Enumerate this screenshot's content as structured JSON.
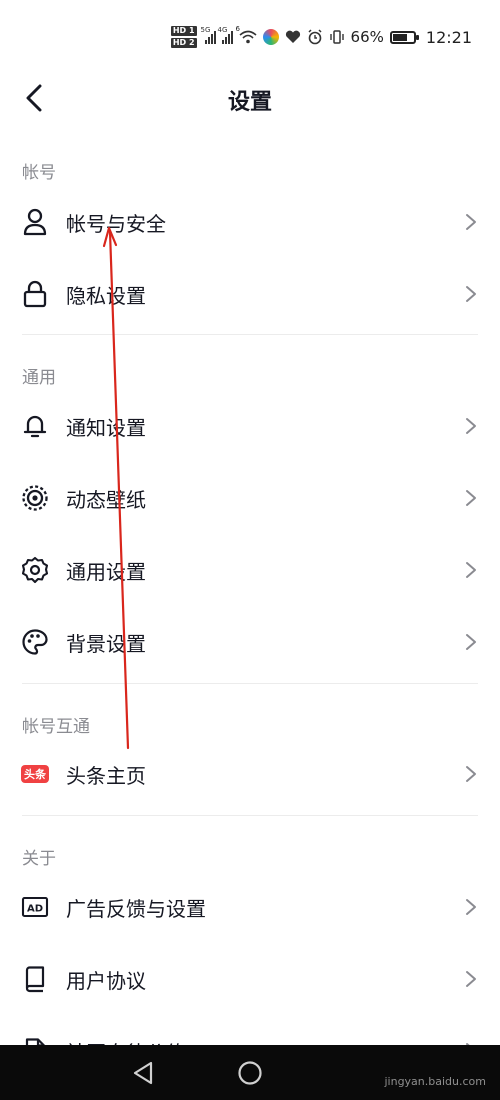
{
  "status_bar": {
    "hd1": "HD 1",
    "hd2": "HD 2",
    "net1": "5G",
    "net2": "4G",
    "wifi_badge": "6",
    "battery_percent": "66%",
    "battery_level": 0.66,
    "time": "12:21"
  },
  "header": {
    "title": "设置"
  },
  "sections": [
    {
      "title": "帐号",
      "items": [
        {
          "label": "帐号与安全",
          "icon": "user-icon"
        },
        {
          "label": "隐私设置",
          "icon": "lock-icon"
        }
      ]
    },
    {
      "title": "通用",
      "items": [
        {
          "label": "通知设置",
          "icon": "bell-icon"
        },
        {
          "label": "动态壁纸",
          "icon": "live-wallpaper-icon"
        },
        {
          "label": "通用设置",
          "icon": "gear-icon"
        },
        {
          "label": "背景设置",
          "icon": "palette-icon"
        }
      ]
    },
    {
      "title": "帐号互通",
      "items": [
        {
          "label": "头条主页",
          "icon": "toutiao-icon",
          "badge": "头条"
        }
      ]
    },
    {
      "title": "关于",
      "items": [
        {
          "label": "广告反馈与设置",
          "icon": "ad-icon",
          "badge": "AD"
        },
        {
          "label": "用户协议",
          "icon": "book-icon"
        },
        {
          "label": "社区自律公约",
          "icon": "document-icon"
        }
      ]
    }
  ],
  "watermark": "jingyan.baidu.com",
  "colors": {
    "text_primary": "#161823",
    "text_secondary": "#8a8b91",
    "annotation_red": "#d9261c",
    "toutiao_red": "#f04142"
  }
}
